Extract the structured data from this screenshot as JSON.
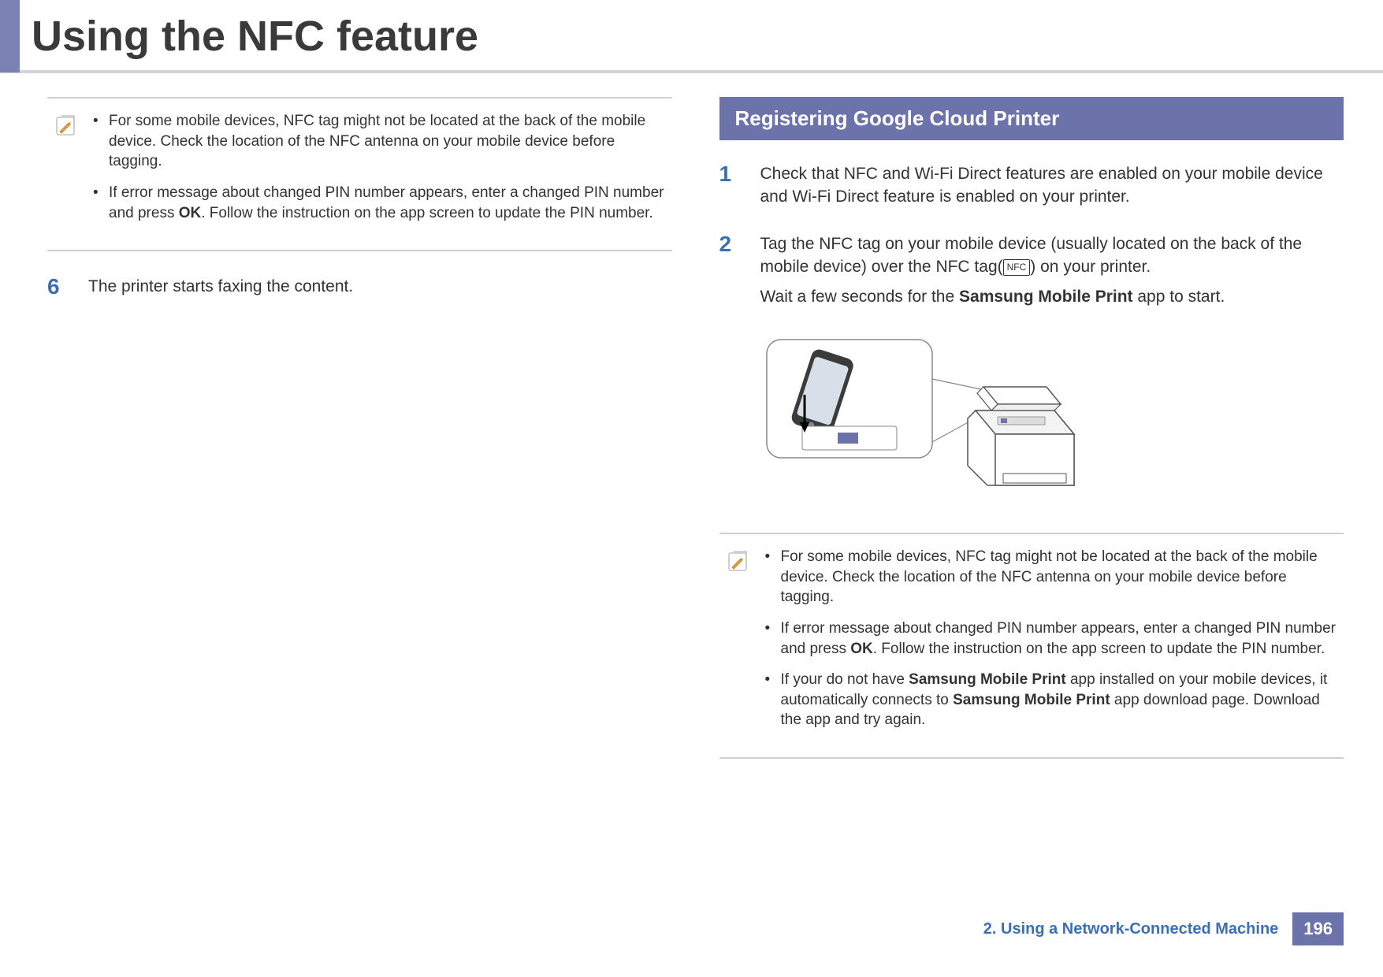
{
  "title": "Using the NFC feature",
  "left_note": {
    "items": [
      "For some mobile devices, NFC tag might not be located at the back of the mobile device. Check the location of the NFC antenna on your mobile device before tagging.",
      "If error message about changed PIN number appears, enter a changed PIN number and press <b>OK</b>. Follow the instruction on the app screen to update the PIN number."
    ]
  },
  "left_steps": [
    {
      "num": "6",
      "text": "The printer starts faxing the content."
    }
  ],
  "right_heading": "Registering Google Cloud Printer",
  "right_steps": [
    {
      "num": "1",
      "text": "Check that NFC and Wi-Fi Direct features are enabled on your mobile device and Wi-Fi Direct feature is enabled on your printer."
    },
    {
      "num": "2",
      "text_pre": "Tag the NFC tag on your mobile device (usually located on the back of the mobile device) over the NFC tag(",
      "nfc_label": "NFC",
      "text_post": ") on your printer.",
      "text2_pre": "Wait a few seconds for the ",
      "text2_bold": "Samsung Mobile Print",
      "text2_post": " app to start."
    }
  ],
  "right_note": {
    "items": [
      "For some mobile devices, NFC tag might not be located at the back of the mobile device. Check the location of the NFC antenna on your mobile device before tagging.",
      "If error message about changed PIN number appears, enter a changed PIN number and press <b>OK</b>. Follow the instruction on the app screen to update the PIN number.",
      "If your do not have <b>Samsung Mobile Print</b> app installed on your mobile devices, it automatically connects to <b>Samsung Mobile Print</b> app download page. Download the app and try again."
    ]
  },
  "footer": {
    "chapter": "2.  Using a Network-Connected Machine",
    "page": "196"
  }
}
